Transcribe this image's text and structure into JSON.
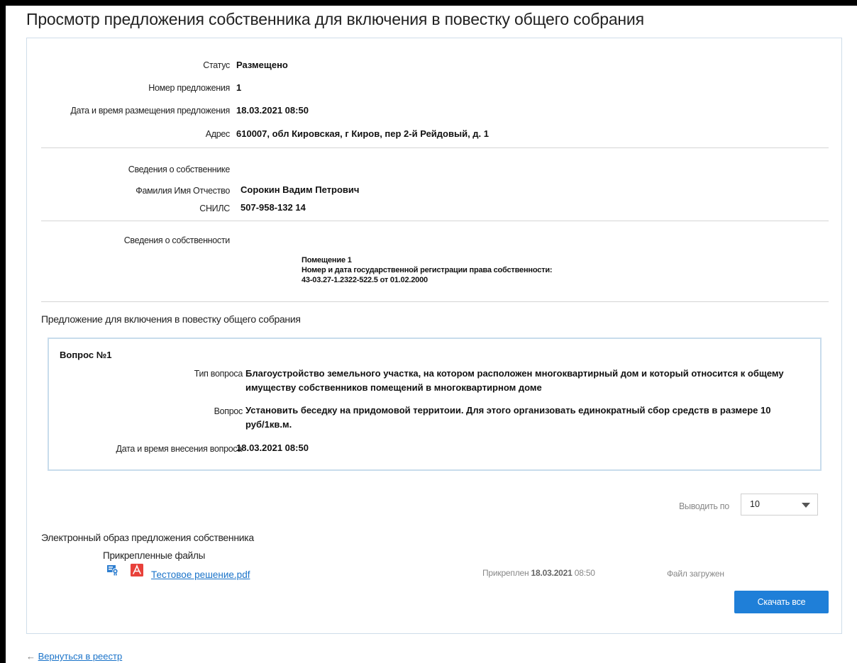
{
  "page": {
    "title": "Просмотр предложения собственника для включения в повестку общего собрания"
  },
  "summary": {
    "status_label": "Статус",
    "status_value": "Размещено",
    "number_label": "Номер предложения",
    "number_value": "1",
    "datetime_label": "Дата и время размещения предложения",
    "datetime_value": "18.03.2021 08:50",
    "address_label": "Адрес",
    "address_value": "610007, обл Кировская, г Киров, пер 2-й Рейдовый, д. 1"
  },
  "owner": {
    "section_label": "Сведения о собственнике",
    "fio_label": "Фамилия Имя Отчество",
    "fio_value": "Сорокин Вадим Петрович",
    "snils_label": "СНИЛС",
    "snils_value": "507-958-132 14"
  },
  "property": {
    "section_label": "Сведения о собственности",
    "room": "Помещение 1",
    "reg_label": "Номер и дата государственной регистрации права собственности:",
    "reg_value": "43-03.27-1.2322-522.5 от 01.02.2000"
  },
  "proposal": {
    "section_title": "Предложение для включения в повестку общего собрания",
    "question": {
      "title": "Вопрос №1",
      "type_label": "Тип вопроса",
      "type_value": "Благоустройство земельного участка, на котором расположен многоквартирный дом и который относится к общему имуществу собственников помещений в многоквартирном доме",
      "question_label": "Вопрос",
      "question_value": "Установить беседку на придомовой территоии. Для этого организовать единократный сбор средств в размере 10 руб/1кв.м.",
      "datetime_label": "Дата и время внесения вопроса",
      "datetime_value": "18.03.2021 08:50"
    }
  },
  "pager": {
    "label": "Выводить по",
    "value": "10"
  },
  "attachments": {
    "section_title": "Электронный образ предложения собственника",
    "files_label": "Прикрепленные файлы",
    "file": {
      "name": "Тестовое решение.pdf",
      "attached_prefix": "Прикреплен",
      "attached_date": "18.03.2021",
      "attached_time": "08:50",
      "status": "Файл загружен"
    },
    "download_all": "Скачать все"
  },
  "nav": {
    "back_arrow": "←",
    "back_link": "Вернуться в реестр"
  },
  "colors": {
    "link": "#1a73c9",
    "button": "#1f7fd8",
    "card_border": "#cfdde9",
    "question_border": "#c8dcec"
  },
  "icons": {
    "signature": "signature-verify-icon",
    "pdf": "pdf-file-icon",
    "dropdown": "chevron-down-icon"
  }
}
